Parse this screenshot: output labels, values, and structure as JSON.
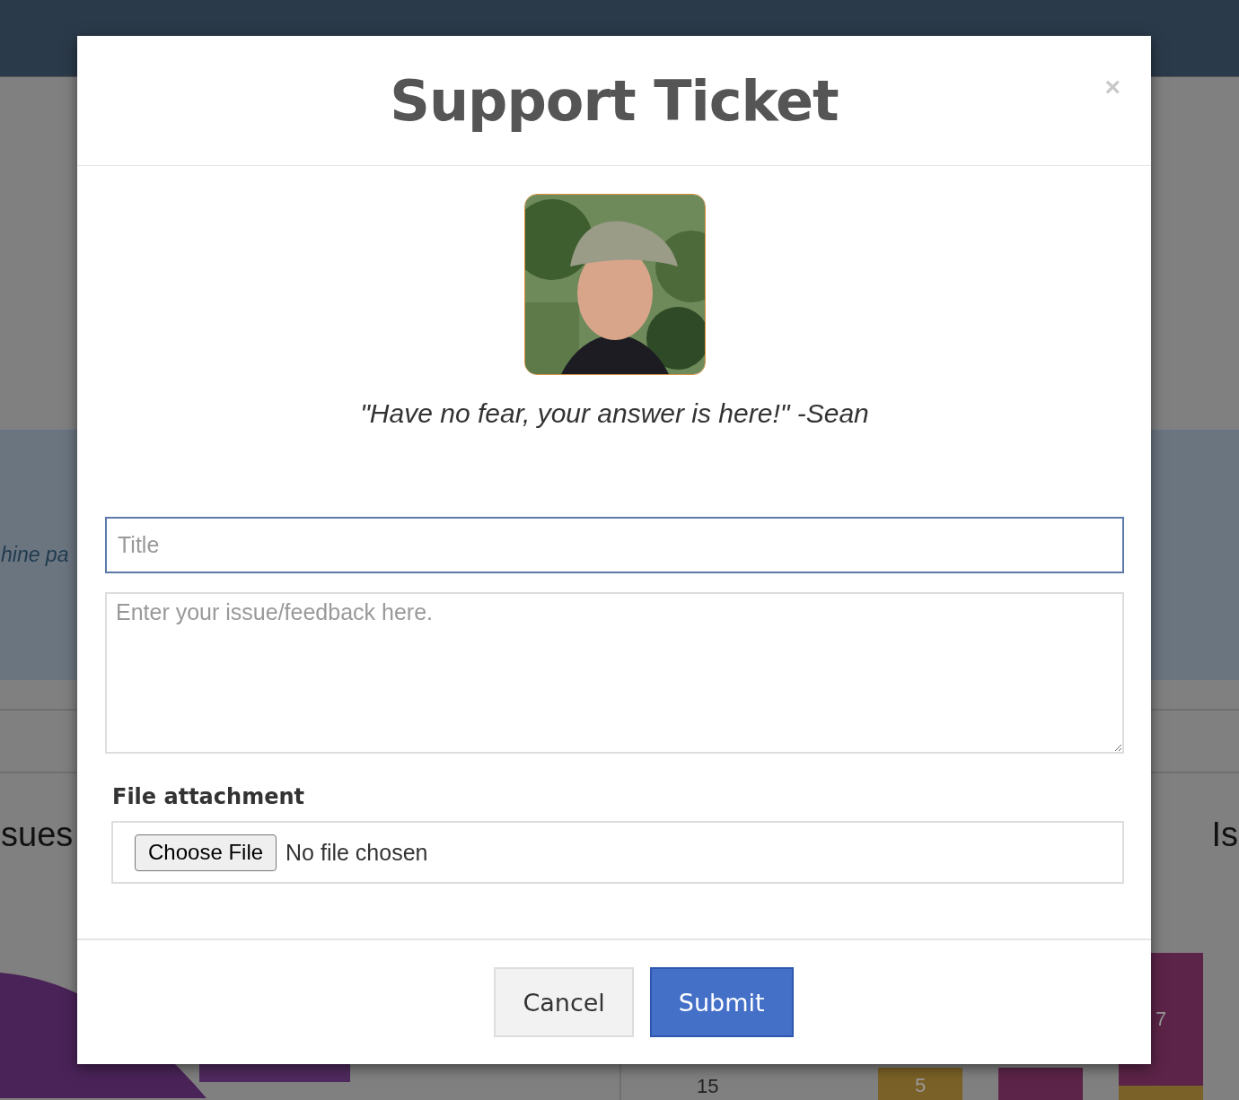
{
  "background": {
    "band_text": "hine pa",
    "left_heading": "sues",
    "right_heading": "Is",
    "chart_tick": "15",
    "bar_labels": [
      "5",
      "7"
    ]
  },
  "modal": {
    "title": "Support Ticket",
    "close": "×",
    "quote": "\"Have no fear, your answer is here!\" -Sean",
    "title_field": {
      "placeholder": "Title",
      "focused": true
    },
    "issue_field": {
      "placeholder": "Enter your issue/feedback here."
    },
    "attachment": {
      "label": "File attachment",
      "button": "Choose File",
      "status": "No file chosen"
    },
    "buttons": [
      {
        "label": "Cancel",
        "kind": "default"
      },
      {
        "label": "Submit",
        "kind": "primary"
      }
    ]
  }
}
